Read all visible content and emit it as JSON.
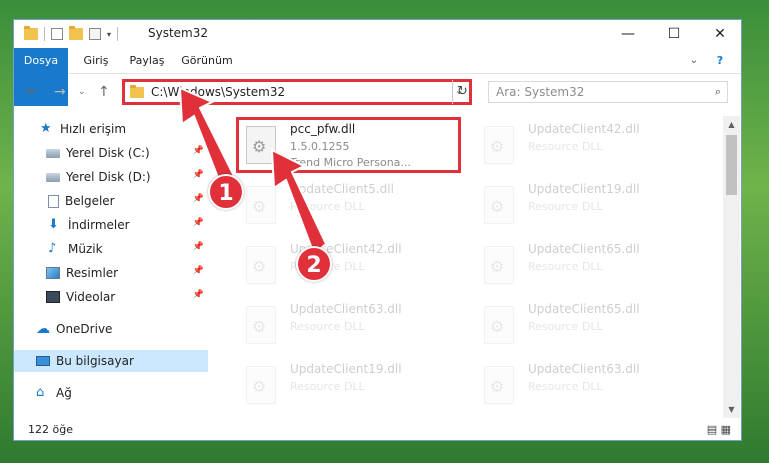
{
  "window": {
    "title": "System32"
  },
  "ribbon": {
    "tabs": [
      "Dosya",
      "Giriş",
      "Paylaş",
      "Görünüm"
    ]
  },
  "address": {
    "path": "C:\\Windows\\System32"
  },
  "search": {
    "placeholder": "Ara: System32"
  },
  "sidebar": {
    "items": [
      {
        "label": "Hızlı erişim",
        "icon": "star-icon",
        "pinned": false
      },
      {
        "label": "Yerel Disk (C:)",
        "icon": "drive-icon",
        "pinned": true
      },
      {
        "label": "Yerel Disk (D:)",
        "icon": "drive-icon",
        "pinned": true
      },
      {
        "label": "Belgeler",
        "icon": "documents-icon",
        "pinned": true
      },
      {
        "label": "İndirmeler",
        "icon": "download-icon",
        "pinned": true
      },
      {
        "label": "Müzik",
        "icon": "music-icon",
        "pinned": true
      },
      {
        "label": "Resimler",
        "icon": "pictures-icon",
        "pinned": true
      },
      {
        "label": "Videolar",
        "icon": "videos-icon",
        "pinned": true
      },
      {
        "label": "OneDrive",
        "icon": "cloud-icon",
        "pinned": false
      },
      {
        "label": "Bu bilgisayar",
        "icon": "computer-icon",
        "pinned": false,
        "selected": true
      },
      {
        "label": "Ağ",
        "icon": "network-icon",
        "pinned": false
      }
    ]
  },
  "files": [
    {
      "name": "pcc_pfw.dll",
      "line2": "1.5.0.1255",
      "line3": "Trend Micro Persona...",
      "highlighted": true
    },
    {
      "name": "UpdateClient42.dll",
      "line2": "Resource DLL",
      "line3": ""
    },
    {
      "name": "UpdateClient5.dll",
      "line2": "Resource DLL",
      "line3": ""
    },
    {
      "name": "UpdateClient19.dll",
      "line2": "Resource DLL",
      "line3": ""
    },
    {
      "name": "UpdateClient42.dll",
      "line2": "Resource DLL",
      "line3": ""
    },
    {
      "name": "UpdateClient65.dll",
      "line2": "Resource DLL",
      "line3": ""
    },
    {
      "name": "UpdateClient63.dll",
      "line2": "Resource DLL",
      "line3": ""
    },
    {
      "name": "UpdateClient65.dll",
      "line2": "Resource DLL",
      "line3": ""
    },
    {
      "name": "UpdateClient19.dll",
      "line2": "Resource DLL",
      "line3": ""
    },
    {
      "name": "UpdateClient63.dll",
      "line2": "Resource DLL",
      "line3": ""
    }
  ],
  "status": {
    "count": "122 öğe"
  },
  "annotations": {
    "step1": "1",
    "step2": "2"
  },
  "colors": {
    "accent": "#1979ca",
    "highlight": "#e0313b",
    "selection": "#cce8ff"
  }
}
